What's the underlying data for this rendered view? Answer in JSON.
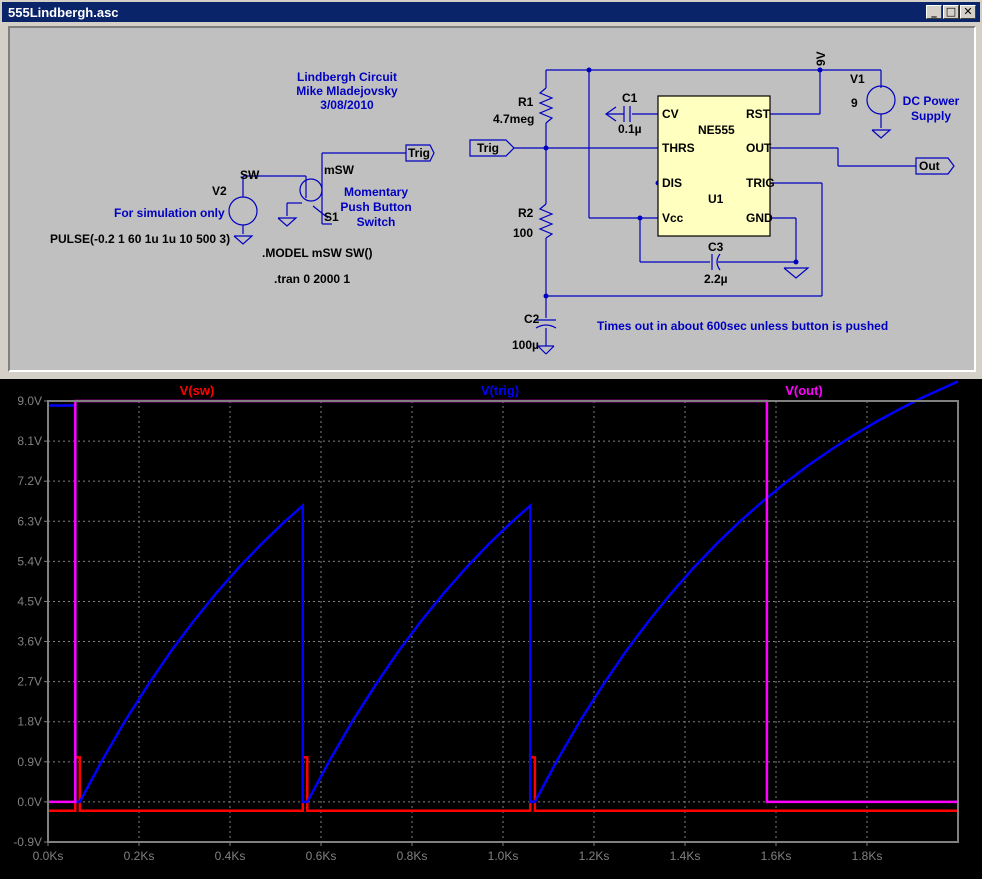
{
  "window": {
    "title": "555Lindbergh.asc",
    "buttons": [
      "_",
      "□",
      "✕"
    ]
  },
  "schematic": {
    "header": [
      "Lindbergh Circuit",
      "Mike Mladejovsky",
      "3/08/2010"
    ],
    "components": {
      "R1": {
        "name": "R1",
        "value": "4.7meg"
      },
      "R2": {
        "name": "R2",
        "value": "100"
      },
      "C1": {
        "name": "C1",
        "value": "0.1µ"
      },
      "C2": {
        "name": "C2",
        "value": "100µ"
      },
      "C3": {
        "name": "C3",
        "value": "2.2µ"
      },
      "V1": {
        "name": "V1",
        "value": "9",
        "desc": [
          "DC Power",
          "Supply"
        ]
      },
      "V2": {
        "name": "V2",
        "desc": "For simulation only",
        "source": "PULSE(-0.2 1 60 1u 1u 10 500 3)"
      },
      "S1": {
        "name": "S1",
        "model": "mSW",
        "desc": [
          "Momentary",
          "Push Button",
          "Switch"
        ]
      },
      "U1": {
        "name": "U1",
        "part": "NE555",
        "pins": {
          "cv": "CV",
          "rst": "RST",
          "thrs": "THRS",
          "out": "OUT",
          "dis": "DIS",
          "trig": "TRIG",
          "vcc": "Vcc",
          "gnd": "GND"
        }
      }
    },
    "nets": {
      "sw": "SW",
      "supply": "9V"
    },
    "flags": {
      "trig1": "Trig",
      "trig2": "Trig",
      "out": "Out"
    },
    "directives": {
      "model": ".MODEL mSW SW()",
      "tran": ".tran 0 2000 1"
    },
    "comment": "Times out in about 600sec unless button is pushed"
  },
  "colors": {
    "sw": "#ff0000",
    "trig": "#0000ff",
    "out": "#ff00ff",
    "grid": "#808080",
    "schem_text": "#0000c0"
  },
  "chart_data": {
    "type": "line",
    "x_unit": "s",
    "xlim": [
      0,
      2000
    ],
    "ylim": [
      -0.9,
      9.0
    ],
    "x_ticks": [
      "0.0Ks",
      "0.2Ks",
      "0.4Ks",
      "0.6Ks",
      "0.8Ks",
      "1.0Ks",
      "1.2Ks",
      "1.4Ks",
      "1.6Ks",
      "1.8Ks"
    ],
    "y_ticks": [
      "9.0V",
      "8.1V",
      "7.2V",
      "6.3V",
      "5.4V",
      "4.5V",
      "3.6V",
      "2.7V",
      "1.8V",
      "0.9V",
      "0.0V",
      "-0.9V"
    ],
    "grid": true,
    "series": [
      {
        "name": "V(sw)",
        "color": "#ff0000",
        "x": [
          0,
          60,
          60,
          70,
          70,
          560,
          560,
          570,
          570,
          1060,
          1060,
          1070,
          1070,
          2000
        ],
        "y": [
          -0.2,
          -0.2,
          1.0,
          1.0,
          -0.2,
          -0.2,
          1.0,
          1.0,
          -0.2,
          -0.2,
          1.0,
          1.0,
          -0.2,
          -0.2
        ]
      },
      {
        "name": "V(trig)",
        "color": "#0000ff",
        "x": [
          0,
          60,
          60,
          70,
          120,
          170,
          220,
          270,
          320,
          370,
          420,
          470,
          520,
          560,
          560,
          570,
          620,
          670,
          720,
          770,
          820,
          870,
          920,
          970,
          1020,
          1060,
          1060,
          1070,
          1120,
          1170,
          1220,
          1270,
          1320,
          1370,
          1420,
          1470,
          1520,
          1570,
          1620,
          1670,
          1720,
          1770,
          1820,
          1870,
          1920,
          1970,
          2000
        ],
        "y": [
          8.9,
          8.9,
          0.0,
          0.0,
          0.95,
          1.83,
          2.63,
          3.38,
          4.06,
          4.69,
          5.27,
          5.8,
          6.29,
          6.65,
          0.0,
          0.0,
          0.95,
          1.83,
          2.63,
          3.38,
          4.06,
          4.69,
          5.27,
          5.8,
          6.29,
          6.65,
          0.0,
          0.0,
          0.95,
          1.83,
          2.63,
          3.38,
          4.06,
          4.69,
          5.27,
          5.8,
          6.29,
          6.74,
          7.16,
          7.55,
          7.9,
          8.23,
          8.53,
          8.81,
          9.07,
          9.3,
          9.44
        ]
      },
      {
        "name": "V(out)",
        "color": "#ff00ff",
        "x": [
          0,
          60,
          60,
          1580,
          1580,
          2000
        ],
        "y": [
          0.0,
          0.0,
          9.0,
          9.0,
          0.0,
          0.0
        ]
      }
    ]
  }
}
